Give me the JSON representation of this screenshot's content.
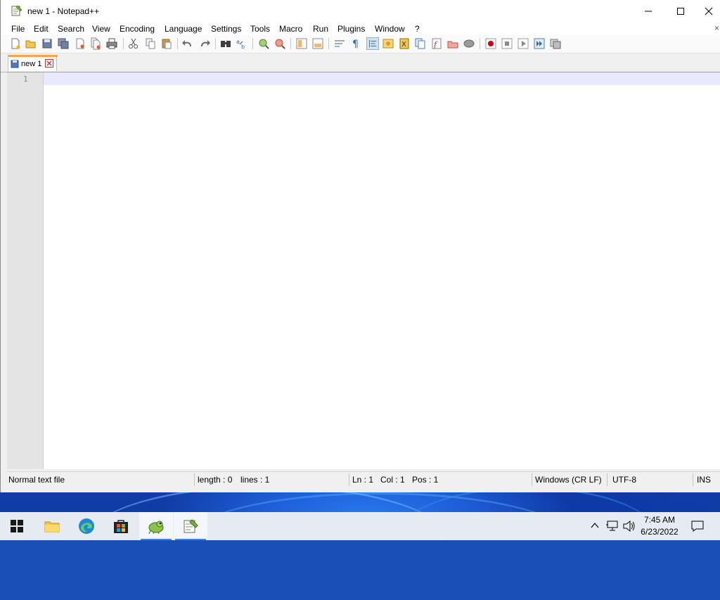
{
  "window": {
    "title": "new 1 - Notepad++"
  },
  "menu": {
    "items": [
      "File",
      "Edit",
      "Search",
      "View",
      "Encoding",
      "Language",
      "Settings",
      "Tools",
      "Macro",
      "Run",
      "Plugins",
      "Window",
      "?"
    ],
    "close_glyph": "×"
  },
  "toolbar": {
    "icons": [
      "new-file-icon",
      "open-file-icon",
      "save-icon",
      "save-all-icon",
      "close-icon",
      "close-all-icon",
      "print-icon",
      "cut-icon",
      "copy-icon",
      "paste-icon",
      "undo-icon",
      "redo-icon",
      "find-icon",
      "replace-icon",
      "zoom-in-icon",
      "zoom-out-icon",
      "sync-vertical-icon",
      "sync-horizontal-icon",
      "word-wrap-icon",
      "show-all-chars-icon",
      "indent-guide-icon",
      "user-language-icon",
      "doc-map-icon",
      "doc-list-icon",
      "function-list-icon",
      "folder-workspace-icon",
      "monitoring-icon",
      "record-macro-icon",
      "stop-recording-icon",
      "playback-macro-icon",
      "run-macro-multiple-icon",
      "save-macro-icon"
    ]
  },
  "tabs": [
    {
      "label": "new 1"
    }
  ],
  "editor": {
    "line_number": "1",
    "content": ""
  },
  "status": {
    "file_type": "Normal text file",
    "length": "length : 0",
    "lines": "lines : 1",
    "ln": "Ln : 1",
    "col": "Col : 1",
    "pos": "Pos : 1",
    "eol": "Windows (CR LF)",
    "encoding": "UTF-8",
    "mode": "INS"
  },
  "taskbar": {
    "items": [
      "start-icon",
      "file-explorer-icon",
      "edge-icon",
      "store-icon",
      "notepadpp-chameleon-icon",
      "notepadpp-icon"
    ],
    "time": "7:45 AM",
    "date": "6/23/2022"
  },
  "colors": {
    "tab_accent": "#f7a54a",
    "current_line": "#e8e8ff",
    "taskbar_indicator": "#3c88dd"
  }
}
